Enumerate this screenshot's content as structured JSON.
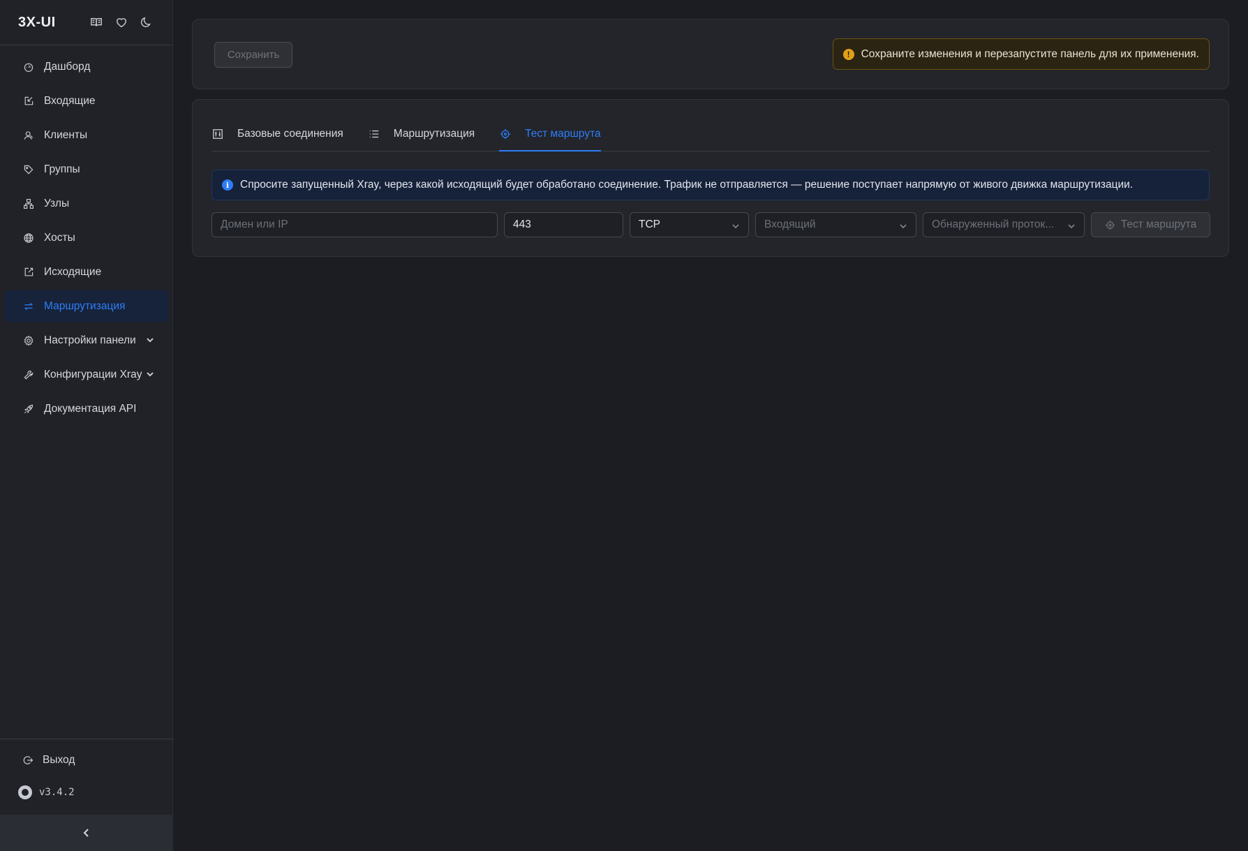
{
  "brand": {
    "title": "3X-UI"
  },
  "sidebar": {
    "items": [
      {
        "label": "Дашборд",
        "icon": "dashboard-icon"
      },
      {
        "label": "Входящие",
        "icon": "inbound-icon"
      },
      {
        "label": "Клиенты",
        "icon": "users-icon"
      },
      {
        "label": "Группы",
        "icon": "tag-icon"
      },
      {
        "label": "Узлы",
        "icon": "cluster-icon"
      },
      {
        "label": "Хосты",
        "icon": "globe-icon"
      },
      {
        "label": "Исходящие",
        "icon": "outbound-icon"
      },
      {
        "label": "Маршрутизация",
        "icon": "swap-icon",
        "active": true
      },
      {
        "label": "Настройки панели",
        "icon": "gear-icon",
        "expandable": true
      },
      {
        "label": "Конфигурации Xray",
        "icon": "wrench-icon",
        "expandable": true
      },
      {
        "label": "Документация API",
        "icon": "rocket-icon"
      }
    ],
    "logout_label": "Выход",
    "version": "v3.4.2"
  },
  "toolbar": {
    "save_label": "Сохранить",
    "warning_text": "Сохраните изменения и перезапустите панель для их применения."
  },
  "tabs": [
    {
      "label": "Базовые соединения",
      "icon": "sliders-icon"
    },
    {
      "label": "Маршрутизация",
      "icon": "list-icon"
    },
    {
      "label": "Тест маршрута",
      "icon": "aim-icon",
      "active": true
    }
  ],
  "info": {
    "text": "Спросите запущенный Xray, через какой исходящий будет обработано соединение. Трафик не отправляется — решение поступает напрямую от живого движка маршрутизации."
  },
  "form": {
    "domain_placeholder": "Домен или IP",
    "port_value": "443",
    "network_value": "TCP",
    "inbound_placeholder": "Входящий",
    "protocol_placeholder": "Обнаруженный проток...",
    "test_button_label": "Тест маршрута"
  },
  "colors": {
    "accent": "#2f7df6",
    "warning": "#e2a017",
    "background": "#1b1d22",
    "sidebar": "#202228"
  }
}
